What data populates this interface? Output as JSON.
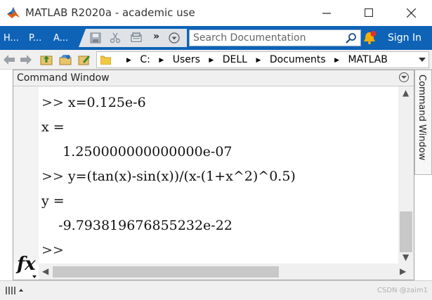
{
  "window": {
    "title": "MATLAB R2020a - academic use"
  },
  "toolstrip": {
    "tabs": [
      "H...",
      "P...",
      "A..."
    ],
    "more": "»",
    "search_placeholder": "Search Documentation",
    "sign_in": "Sign In"
  },
  "address": {
    "crumbs": [
      "C:",
      "Users",
      "DELL",
      "Documents",
      "MATLAB"
    ]
  },
  "panel": {
    "title": "Command Window",
    "side_tab": "Command Window",
    "lines": [
      {
        "prompt": ">>",
        "text": " x=0.125e-6"
      },
      {
        "prompt": "",
        "text": "x ="
      },
      {
        "prompt": "",
        "text": "     1.250000000000000e-07"
      },
      {
        "prompt": ">>",
        "text": " y=(tan(x)-sin(x))/(x-(1+x^2)^0.5)"
      },
      {
        "prompt": "",
        "text": "y ="
      },
      {
        "prompt": "",
        "text": "    -9.793819676855232e-22"
      },
      {
        "prompt": ">>",
        "text": ""
      }
    ],
    "fx": "fx"
  },
  "status": {
    "watermark": "CSDN @zaim1"
  },
  "colors": {
    "toolstrip": "#0e63b7",
    "accent": "#ff7a00"
  }
}
